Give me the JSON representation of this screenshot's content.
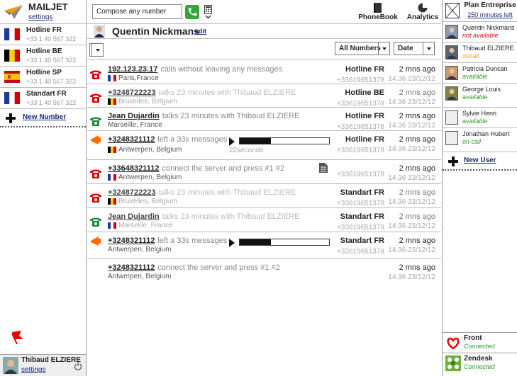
{
  "brand": {
    "name": "MAILJET",
    "settings": "settings"
  },
  "colors": {
    "accent_green": "#37a53b",
    "status_red": "#d01010",
    "status_orange": "#f0a000",
    "status_green": "#2a9a2a",
    "call_red": "#e00000"
  },
  "lines": [
    {
      "name": "Hotline FR",
      "number": "+33 1 40 567 322",
      "flag": "fr"
    },
    {
      "name": "Hotline BE",
      "number": "+33 1 40 567 322",
      "flag": "be"
    },
    {
      "name": "Hotline SP",
      "number": "+33 1 40 567 322",
      "flag": "es"
    },
    {
      "name": "Standart FR",
      "number": "+33 1 40 567 322",
      "flag": "fr"
    }
  ],
  "new_number": "New Number",
  "current_user": {
    "name": "Thibaud ELZIERE",
    "settings": "settings"
  },
  "topbar": {
    "compose_placeholder": "Compose any number",
    "phonebook": "PhoneBook",
    "analytics": "Analytics"
  },
  "contact": {
    "name": "Quentin Nickmans",
    "edit": "edit"
  },
  "filters": {
    "numbers": "All Numbers",
    "sort": "Date"
  },
  "feed": [
    {
      "type": "call-missed",
      "link": "192.123.23.17",
      "text": "calls without leaving any messages",
      "location": "Paris,France",
      "flag": "fr",
      "line": "Hotline FR",
      "line_number": "+33619651378",
      "ago": "2 mns ago",
      "date": "14:36 23/12/12"
    },
    {
      "type": "call-missed",
      "dim": true,
      "link": "+3248722223",
      "text": "talks 23 minutes with Thibaud ELZIERE",
      "location": "Bruxelles, Belgium",
      "flag": "be",
      "line": "Hotline BE",
      "line_number": "+33619651378",
      "ago": "2 mns ago",
      "date": "14:36 23/12/12"
    },
    {
      "type": "call-answered",
      "link": "Jean Dujardin",
      "text": "talks 23 minutes with Thibaud ELZIERE",
      "location": "Marseille, France",
      "line": "Hotline FR",
      "line_number": "+33619651378",
      "ago": "2 mns ago",
      "date": "14:36 23/12/12"
    },
    {
      "type": "voicemail",
      "link": "+3248321112",
      "text": "left a 33s messages",
      "location": "Antwerpen, Belgium",
      "flag": "be",
      "duration": "22seconds",
      "progress": 0.35,
      "line": "Hotline FR",
      "line_number": "+33619651378",
      "ago": "2 mns ago",
      "date": "14:36 23/12/12"
    },
    {
      "type": "call-missed",
      "link": "+33648321112",
      "text": "connect the server and press #1 #2",
      "location": "Antwerpen, Belgium",
      "flag": "fr",
      "line": "",
      "line_number": "+33619651378",
      "ago": "2 mns ago",
      "date": "14:36 23/12/12"
    },
    {
      "type": "call-missed",
      "dim": true,
      "link": "+3248722223",
      "text": "talks 23 minutes with Thibaud ELZIERE",
      "location": "Bruxelles, Belgium",
      "flag": "be",
      "line": "Standart FR",
      "line_number": "+33619651378",
      "ago": "2 mns ago",
      "date": "14:36 23/12/12"
    },
    {
      "type": "call-answered",
      "dim": true,
      "link": "Jean Dujardin",
      "text": "talks 23 minutes with Thibaud ELZIERE",
      "location": "Marseille, France",
      "flag": "fr",
      "line": "Standart FR",
      "line_number": "+33619651378",
      "ago": "2 mns ago",
      "date": "14:36 23/12/12"
    },
    {
      "type": "voicemail",
      "link": "+3248321112",
      "text": "left a 33s messages",
      "location": "Antwerpen, Belgium",
      "progress": 0.35,
      "line": "Standart FR",
      "line_number": "+33619651378",
      "ago": "2 mns ago",
      "date": "14:36 23/12/12"
    },
    {
      "type": "none",
      "link": "+3248321112",
      "text": "connect the server and press #1 #2",
      "location": "Antwerpen, Belgium",
      "line": "",
      "line_number": "",
      "ago": "2 mns ago",
      "date": "14:36 23/12/12"
    }
  ],
  "plan": {
    "name": "Plan Entreprise",
    "minutes": "250 minutes left"
  },
  "users": [
    {
      "name": "Quentin Nickmans",
      "status": "not available",
      "status_color": "#d01010",
      "avatar": "photo"
    },
    {
      "name": "Thibaud ELZIERE",
      "status": "oncall",
      "status_color": "#f0a000",
      "avatar": "photo"
    },
    {
      "name": "Patricia Duncan",
      "status": "available",
      "status_color": "#2a9a2a",
      "avatar": "photo"
    },
    {
      "name": "George Louis",
      "status": "available",
      "status_color": "#2a9a2a",
      "avatar": "photo"
    },
    {
      "name": "Sylvie Henri",
      "status": "available",
      "status_color": "#2a9a2a",
      "avatar": "blank"
    },
    {
      "name": "Jonathan Hubert",
      "status": "on call",
      "status_color": "#2a9a2a",
      "avatar": "blank"
    }
  ],
  "new_user": "New User",
  "integrations": [
    {
      "name": "Front",
      "status": "Connected",
      "icon": "front-heart-icon"
    },
    {
      "name": "Zendesk",
      "status": "Connected",
      "icon": "zendesk-icon"
    }
  ]
}
